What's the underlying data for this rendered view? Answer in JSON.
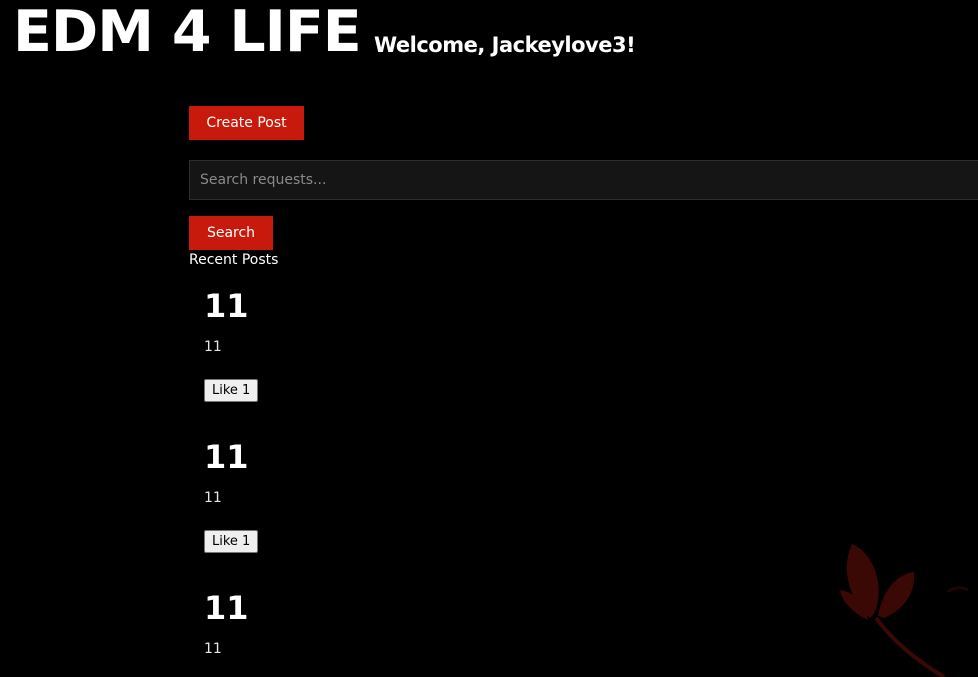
{
  "header": {
    "site_title": "EDM 4 LIFE",
    "welcome": "Welcome, Jackeylove3!"
  },
  "actions": {
    "create_post_label": "Create Post"
  },
  "search": {
    "placeholder": "Search requests...",
    "value": "",
    "button_label": "Search"
  },
  "recent": {
    "heading": "Recent Posts"
  },
  "posts": [
    {
      "title": "11",
      "body": "11",
      "like_label": "Like 1"
    },
    {
      "title": "11",
      "body": "11",
      "like_label": "Like 1"
    },
    {
      "title": "11",
      "body": "11"
    }
  ],
  "colors": {
    "background": "#000000",
    "accent": "#c8190d",
    "decoration": "#3a0805"
  },
  "decoration": {
    "icon": "flower-icon"
  }
}
